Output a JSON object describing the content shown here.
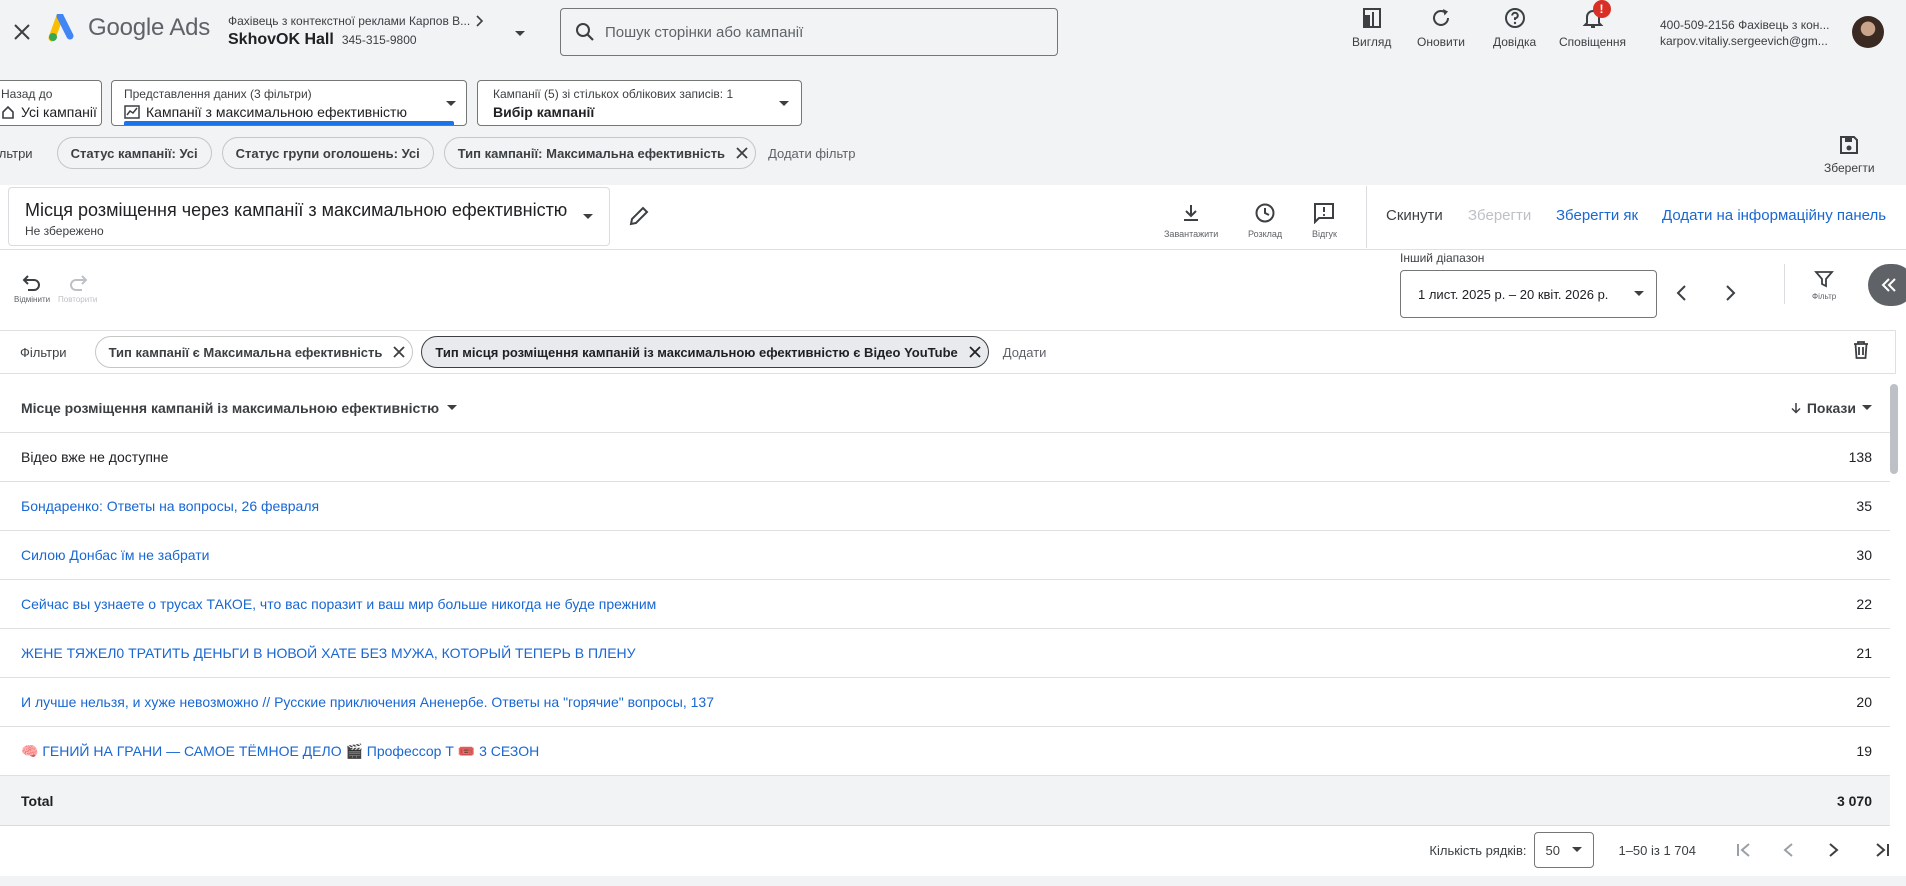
{
  "header": {
    "logo_text": "Google Ads",
    "account_parent": "Фахівець з контекстної реклами Карпов В...",
    "account_name": "SkhovOK Hall",
    "account_id": "345-315-9800",
    "search_placeholder": "Пошук сторінки або кампанії",
    "tools": [
      {
        "label": "Вигляд",
        "icon": "view-icon"
      },
      {
        "label": "Оновити",
        "icon": "refresh-icon"
      },
      {
        "label": "Довідка",
        "icon": "help-icon"
      },
      {
        "label": "Сповіщення",
        "icon": "bell-icon",
        "badge": "!"
      }
    ],
    "user_line1": "400-509-2156 Фахівець з кон...",
    "user_line2": "karpov.vitaliy.sergeevich@gm..."
  },
  "nav": {
    "back_label": "Назад до",
    "back_value": "Усі кампанії",
    "dataview_label": "Представлення даних (3 фільтри)",
    "dataview_value": "Кампанії з максимальною ефективністю",
    "campaigns_label": "Кампанії (5) зі стількох облікових записів: 1",
    "campaigns_value": "Вибір кампанії"
  },
  "filterbar": {
    "label": "Фільтри",
    "chips": [
      "Статус кампанії: Усі",
      "Статус групи оголошень: Усі",
      "Тип кампанії: Максимальна ефективність"
    ],
    "add_label": "Додати фільтр",
    "save_label": "Зберегти"
  },
  "report": {
    "title": "Місця розміщення через кампанії з максимальною ефективністю",
    "subtitle": "Не збережено",
    "download_label": "Завантажити",
    "schedule_label": "Розклад",
    "feedback_label": "Відгук",
    "reset_label": "Скинути",
    "save_label": "Зберегти",
    "save_as_label": "Зберегти як",
    "add_dashboard_label": "Додати на інформаційну панель",
    "undo_label": "Відмінити",
    "redo_label": "Повторити",
    "range_label": "Інший діапазон",
    "range_value": "1 лист. 2025 р. – 20 квіт. 2026 р.",
    "filter_label": "Фільтр"
  },
  "report_filters": {
    "label": "Фільтри",
    "chips": [
      "Тип кампанії є Максимальна ефективність",
      "Тип місця розміщення кампаній із максимальною ефективністю є Відео YouTube"
    ],
    "add_label": "Додати"
  },
  "table": {
    "col_name": "Місце розміщення кампаній із максимальною ефективністю",
    "col_value": "Покази",
    "rows": [
      {
        "name": "Відео вже не доступне",
        "value": "138",
        "link": false
      },
      {
        "name": "Бондаренко: Ответы на вопросы, 26 февраля",
        "value": "35",
        "link": true
      },
      {
        "name": "Силою Донбас їм не забрати",
        "value": "30",
        "link": true
      },
      {
        "name": "Сейчас вы узнаете о трусах ТАКОЕ, что вас поразит и ваш мир больше никогда не буде прежним",
        "value": "22",
        "link": true
      },
      {
        "name": "ЖЕНЕ ТЯЖЕЛ0 ТРАТИТЬ ДЕНЬГИ В НОВОЙ ХАТЕ БЕЗ МУЖА, КОТОРЫЙ ТЕПЕРЬ В ПЛЕНУ",
        "value": "21",
        "link": true
      },
      {
        "name": "И лучше нельзя, и хуже невозможно // Русские приключения Аненербе. Ответы на \"горячие\" вопросы, 137",
        "value": "20",
        "link": true
      },
      {
        "name": "🧠 ГЕНИЙ НА ГРАНИ — САМОЕ ТЁМНОЕ ДЕЛО 🎬 Профессор Т 🎟️ 3 СЕЗОН",
        "value": "19",
        "link": true
      }
    ],
    "total_label": "Total",
    "total_value": "3 070"
  },
  "pager": {
    "rows_label": "Кількість рядків:",
    "rows_value": "50",
    "range_text": "1–50 із 1 704"
  },
  "colors": {
    "link": "#1967d2",
    "brand_blue": "#1a73e8",
    "badge_red": "#d93025"
  }
}
